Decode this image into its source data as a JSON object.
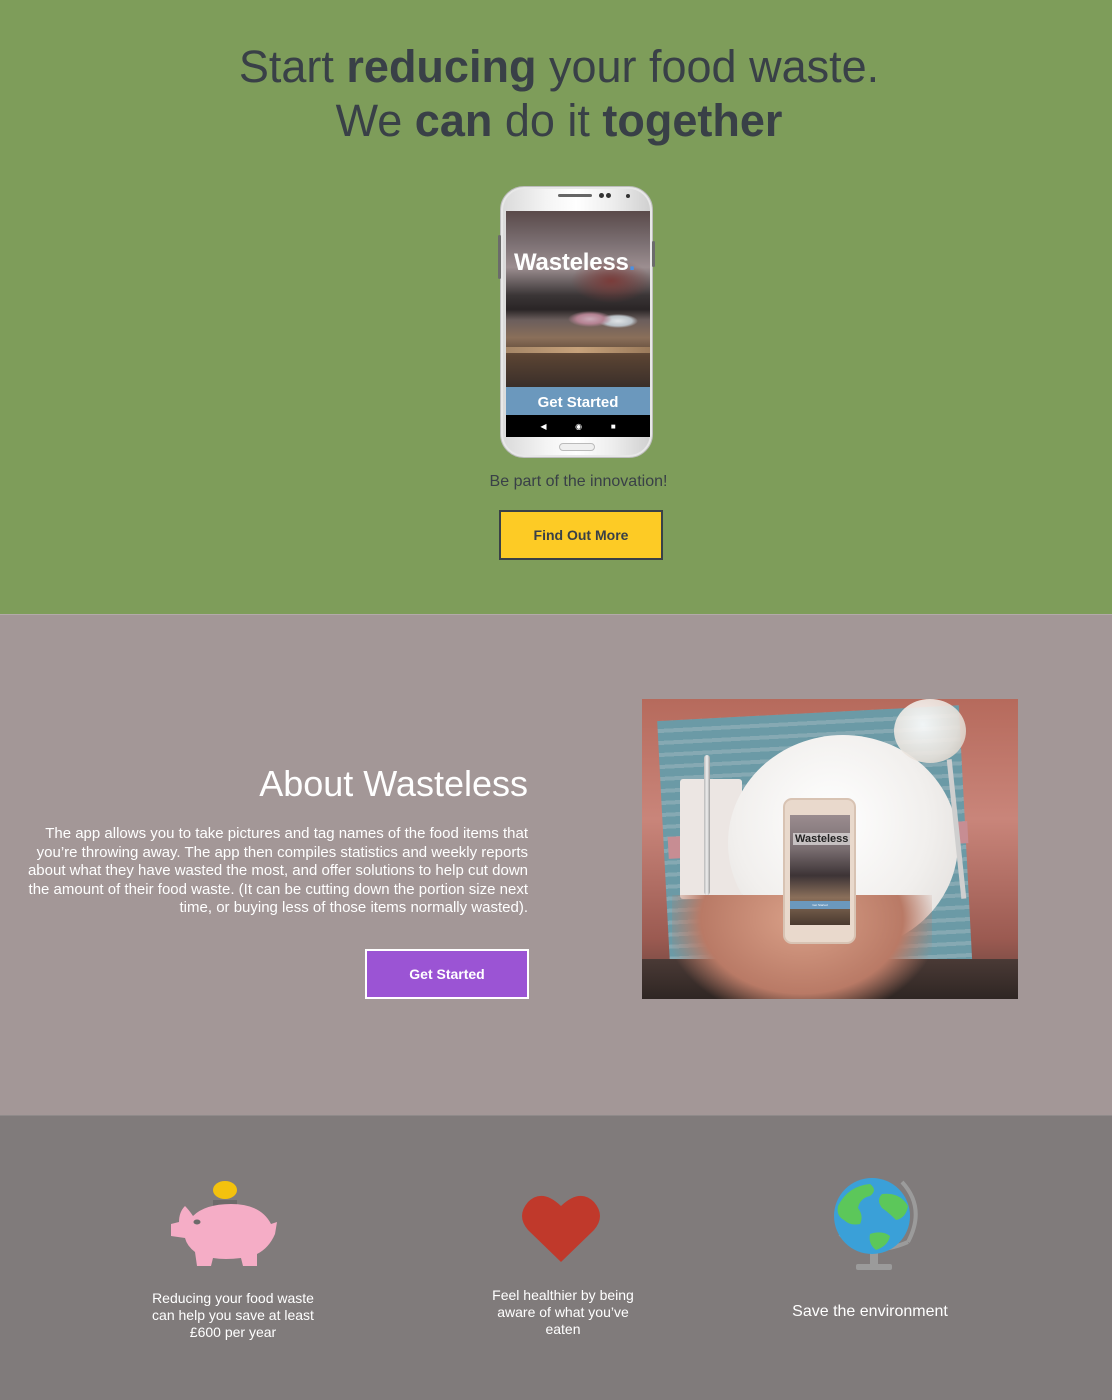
{
  "hero": {
    "title_line1": {
      "pre": "Start ",
      "bold": "reducing",
      "post": " your food waste."
    },
    "title_line2": {
      "pre": "We ",
      "bold1": "can",
      "mid": " do it ",
      "bold2": "together"
    },
    "tagline": "Be part of the innovation!",
    "cta_label": "Find Out More",
    "phone": {
      "app_name": "Wasteless",
      "app_name_dot": ".",
      "screen_button": "Get Started",
      "nav_back": "◀",
      "nav_home": "◉",
      "nav_recent": "■"
    },
    "colors": {
      "background": "#7e9d5a",
      "cta": "#fdcb25",
      "text": "#394047"
    }
  },
  "about": {
    "title": "About Wasteless",
    "body": "The app allows you to take pictures and tag names of the food items that you’re throwing away. The app then compiles statistics and weekly reports about what they have wasted the most, and offer solutions to help cut down the amount of their food waste. (It can be cutting down the portion size next time, or buying less of those items normally wasted).",
    "cta_label": "Get Started",
    "photo": {
      "phone_app_name": "Wasteless",
      "phone_button": "Get Started"
    },
    "colors": {
      "background": "#a39797",
      "cta": "#9b54d4"
    }
  },
  "features": {
    "items": [
      {
        "icon": "piggy-bank-icon",
        "text": "Reducing your food waste can help you save at least £600 per year"
      },
      {
        "icon": "heart-icon",
        "text": "Feel healthier by being aware of what you’ve eaten"
      },
      {
        "icon": "globe-icon",
        "text": "Save the environment"
      }
    ],
    "colors": {
      "background": "#807b7b",
      "piggy": "#f5adc6",
      "coin": "#f4c20d",
      "heart": "#c0392b",
      "globe_water": "#3aa0d8",
      "globe_land": "#5cc75a"
    }
  }
}
